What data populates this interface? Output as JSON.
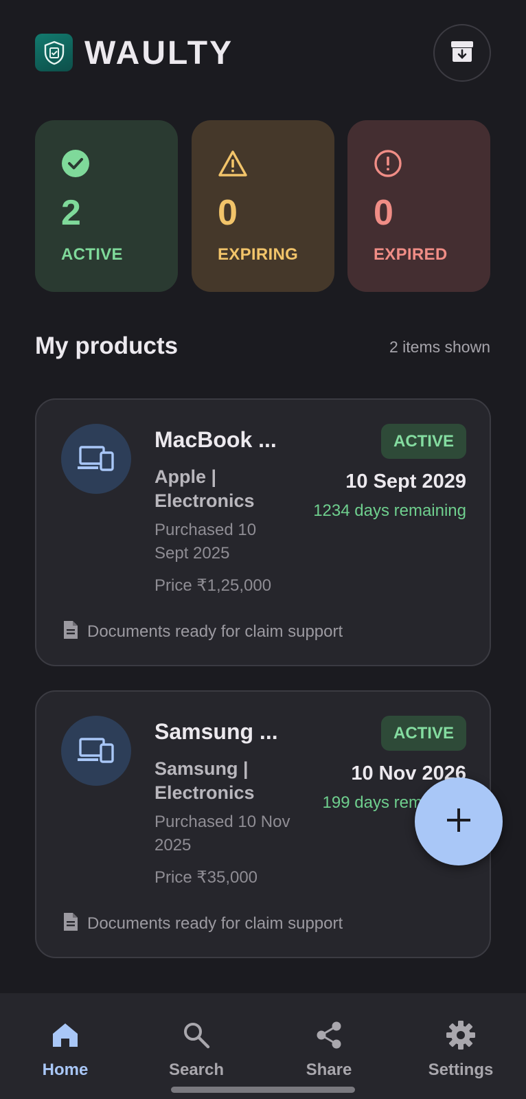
{
  "header": {
    "brand": "WAULTY",
    "icons": {
      "logo": "shield-check-icon",
      "archive": "archive-box-icon"
    }
  },
  "stats": [
    {
      "key": "active",
      "value": "2",
      "label": "ACTIVE",
      "icon": "check-circle-icon",
      "color": "#7fd99a"
    },
    {
      "key": "expiring",
      "value": "0",
      "label": "EXPIRING",
      "icon": "warning-triangle-icon",
      "color": "#f2c46a"
    },
    {
      "key": "expired",
      "value": "0",
      "label": "EXPIRED",
      "icon": "alert-circle-icon",
      "color": "#f08d86"
    }
  ],
  "section": {
    "title": "My products",
    "count": "2 items shown"
  },
  "products": [
    {
      "name": "MacBook ...",
      "brand_line": "Apple  |",
      "category": "Electronics",
      "purchased": "Purchased 10 Sept 2025",
      "price": "Price ₹1,25,000",
      "status": "ACTIVE",
      "expiry": "10 Sept 2029",
      "remaining": "1234 days remaining",
      "docs": "Documents ready for claim support"
    },
    {
      "name": "Samsung ...",
      "brand_line": "Samsung  |",
      "category": "Electronics",
      "purchased": "Purchased 10 Nov 2025",
      "price": "Price ₹35,000",
      "status": "ACTIVE",
      "expiry": "10 Nov 2026",
      "remaining": "199 days remaining",
      "docs": "Documents ready for claim support"
    }
  ],
  "fab": {
    "icon": "plus-icon"
  },
  "nav": [
    {
      "label": "Home",
      "icon": "home-icon",
      "active": true
    },
    {
      "label": "Search",
      "icon": "search-icon",
      "active": false
    },
    {
      "label": "Share",
      "icon": "share-icon",
      "active": false
    },
    {
      "label": "Settings",
      "icon": "gear-icon",
      "active": false
    }
  ],
  "colors": {
    "accent": "#a9c7f7",
    "background": "#1b1b20",
    "card": "#26262c",
    "success": "#7fd99a"
  }
}
